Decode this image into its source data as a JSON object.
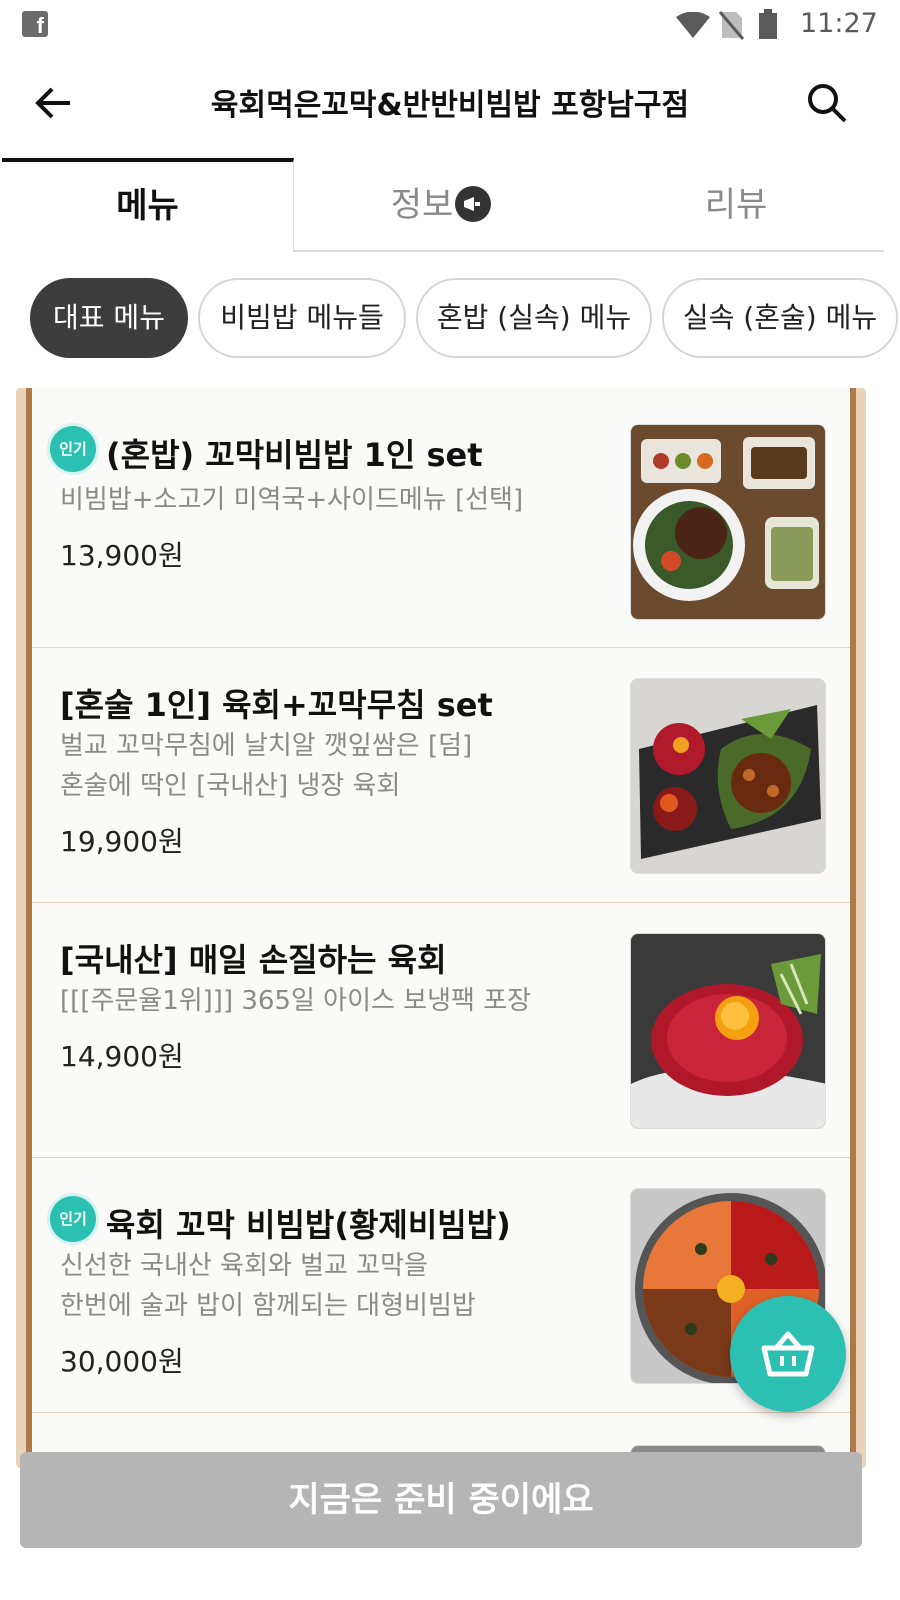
{
  "status_bar": {
    "time": "11:27"
  },
  "header": {
    "title": "육회먹은꼬막&반반비빔밥 포항남구점"
  },
  "tabs": [
    {
      "label": "메뉴"
    },
    {
      "label": "정보"
    },
    {
      "label": "리뷰"
    }
  ],
  "categories": [
    {
      "label": "대표 메뉴"
    },
    {
      "label": "비빔밥 메뉴들"
    },
    {
      "label": "혼밥 (실속) 메뉴"
    },
    {
      "label": "실속 (혼술) 메뉴"
    }
  ],
  "menu_items": [
    {
      "badge": "인기",
      "name": "(혼밥) 꼬막비빔밥 1인 set",
      "desc1": "비빔밥+소고기 미역국+사이드메뉴 [선택]",
      "desc2": "",
      "price": "13,900원"
    },
    {
      "badge": "",
      "name": "[혼술 1인] 육회+꼬막무침 set",
      "desc1": "벌교 꼬막무침에 날치알 깻잎쌈은 [덤]",
      "desc2": "혼술에 딱인 [국내산] 냉장 육회",
      "price": "19,900원"
    },
    {
      "badge": "",
      "name": "[국내산] 매일 손질하는 육회",
      "desc1": "[[[주문율1위]]] 365일 아이스 보냉팩 포장",
      "desc2": "",
      "price": "14,900원"
    },
    {
      "badge": "인기",
      "name": "육회 꼬막 비빔밥(황제비빔밥)",
      "desc1": "신선한 국내산 육회와 벌교 꼬막을",
      "desc2": "한번에 술과 밥이 함께되는 대형비빔밥",
      "price": "30,000원"
    }
  ],
  "bottom_bar": {
    "label": "지금은 준비 중이에요"
  },
  "colors": {
    "accent": "#2cc0b2",
    "frame_wood": "#b07a48",
    "disabled": "#b5b5b5"
  }
}
